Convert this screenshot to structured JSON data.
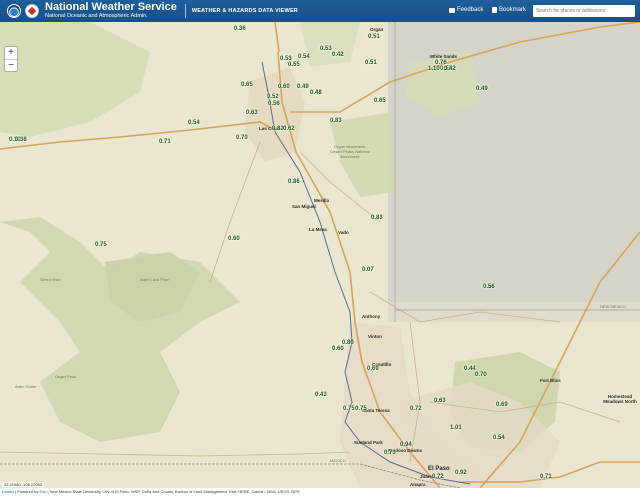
{
  "header": {
    "title": "National Weather Service",
    "subtitle": "National Oceanic and Atmospheric Admin.",
    "viewer_title": "WEATHER & HAZARDS DATA VIEWER",
    "feedback_label": "Feedback",
    "bookmark_label": "Bookmark",
    "search_placeholder": "Search for places or addresses"
  },
  "zoom": {
    "in": "+",
    "out": "−"
  },
  "observations": [
    {
      "v": "0.36"
    },
    {
      "v": "0.51"
    },
    {
      "v": "0.53"
    },
    {
      "v": "0.42"
    },
    {
      "v": "0.51"
    },
    {
      "v": "0.53"
    },
    {
      "v": "0.55"
    },
    {
      "v": "0.54"
    },
    {
      "v": "0.76"
    },
    {
      "v": "0.55"
    },
    {
      "v": "0.65"
    },
    {
      "v": "0.60"
    },
    {
      "v": "0.49"
    },
    {
      "v": "0.48"
    },
    {
      "v": "0.52"
    },
    {
      "v": "0.56"
    },
    {
      "v": "0.65"
    },
    {
      "v": "0.63"
    },
    {
      "v": "0.39"
    },
    {
      "v": "0.83"
    },
    {
      "v": "0.54"
    },
    {
      "v": "0.83"
    },
    {
      "v": "0.62"
    },
    {
      "v": "0.70"
    },
    {
      "v": "0.38"
    },
    {
      "v": "0.71"
    },
    {
      "v": "0.86"
    },
    {
      "v": "0.49"
    },
    {
      "v": "0.83"
    },
    {
      "v": "0.75"
    },
    {
      "v": "0.60"
    },
    {
      "v": "0.07"
    },
    {
      "v": "0.56"
    },
    {
      "v": "0.80"
    },
    {
      "v": "0.60"
    },
    {
      "v": "0.69"
    },
    {
      "v": "0.44"
    },
    {
      "v": "0.70"
    },
    {
      "v": "0.43"
    },
    {
      "v": "0.75"
    },
    {
      "v": "0.72"
    },
    {
      "v": "0.63"
    },
    {
      "v": "0.69"
    },
    {
      "v": "0.73"
    },
    {
      "v": "1.01"
    },
    {
      "v": "0.94"
    },
    {
      "v": "0.92"
    },
    {
      "v": "0.54"
    },
    {
      "v": "0.71"
    },
    {
      "v": "0.72"
    },
    {
      "v": "0.75"
    },
    {
      "v": "1.10"
    },
    {
      "v": "0.42"
    }
  ],
  "places": [
    "Organ",
    "White Sands",
    "Las Cruces",
    "Mesilla",
    "San Miguel",
    "La Mesa",
    "Vado",
    "Organ Mountains-Desert Peaks National Monument",
    "Aden Lava Flow",
    "Sierra Vista",
    "Anthony",
    "Vinton",
    "Canutillo",
    "Santa Teresa",
    "Sunland Park",
    "Ruidoso Downs",
    "Anapra",
    "El Paso",
    "Juárez",
    "Fort Bliss",
    "Homestead Meadows North",
    "MEXICO",
    "NEW MEXICO",
    "Organ Peak",
    "Aden Crater"
  ],
  "coords": "32.21580 -106.22063",
  "footer": {
    "leaflet": "Leaflet",
    "powered": " | Powered by ",
    "esri": "Esri",
    "credits": " | New Mexico State University, City of El Paso, WSP, Doña Ana County, Bureau of Land Management, Esri, HERE, Garmin, NGA, USGS, NPS"
  }
}
